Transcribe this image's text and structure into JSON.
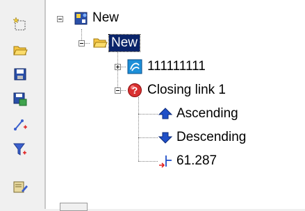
{
  "toolbar": {
    "tools": [
      {
        "icon": "new-item-icon"
      },
      {
        "icon": "open-folder-icon"
      },
      {
        "icon": "save-icon"
      },
      {
        "icon": "save-as-icon"
      },
      {
        "icon": "add-link-icon"
      },
      {
        "icon": "add-filter-icon"
      },
      {
        "icon": "edit-icon"
      }
    ]
  },
  "tree": {
    "root": {
      "label": "New",
      "icon": "project-icon"
    },
    "folder": {
      "label": "New",
      "icon": "folder-icon",
      "selected": true
    },
    "item": {
      "label": "111111111",
      "icon": "data-source-icon"
    },
    "closing": {
      "label": "Closing link 1",
      "icon": "question-icon"
    },
    "children": [
      {
        "label": "Ascending",
        "icon": "arrow-up-icon"
      },
      {
        "label": "Descending",
        "icon": "arrow-down-icon"
      },
      {
        "label": "61.287",
        "icon": "threshold-icon"
      }
    ]
  }
}
